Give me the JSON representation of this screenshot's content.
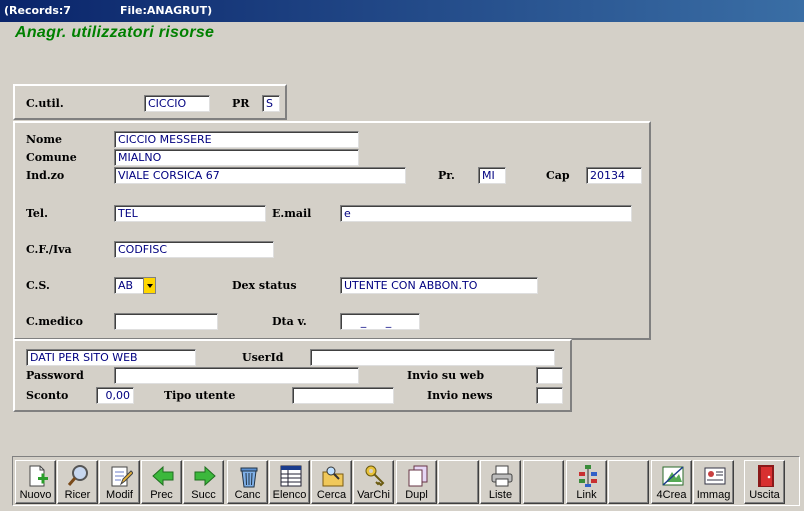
{
  "titlebar": {
    "records": "(Records:7",
    "file": "File:ANAGRUT)"
  },
  "heading": "Anagr. utilizzatori risorse",
  "form": {
    "cutil_label": "C.util.",
    "cutil_value": "CICCIO",
    "pr_top_label": "PR",
    "pr_top_value": "S",
    "nome_label": "Nome",
    "nome_value": "CICCIO MESSERE",
    "comune_label": "Comune",
    "comune_value": "MIALNO",
    "indzo_label": "Ind.zo",
    "indzo_value": "VIALE CORSICA 67",
    "prov_label": "Pr.",
    "prov_value": "MI",
    "cap_label": "Cap",
    "cap_value": "20134",
    "tel_label": "Tel.",
    "tel_value": "TEL",
    "email_label": "E.mail",
    "email_value": "e",
    "cf_label": "C.F./Iva",
    "cf_value": "CODFISC",
    "cs_label": "C.S.",
    "cs_value": "AB",
    "dexstatus_label": "Dex status",
    "dexstatus_value": "UTENTE CON ABBON.TO",
    "cmedico_label": "C.medico",
    "cmedico_value": "",
    "dtav_label": "Dta v.",
    "dtav_value": "_ _",
    "sitoweb_value": "DATI PER SITO WEB",
    "userid_label": "UserId",
    "userid_value": "",
    "password_label": "Password",
    "password_value": "",
    "inviosuweb_label": "Invio su web",
    "inviosuweb_value": "",
    "sconto_label": "Sconto",
    "sconto_value": "0,00",
    "tipoutente_label": "Tipo utente",
    "tipoutente_value": "",
    "invionews_label": "Invio news",
    "invionews_value": ""
  },
  "toolbar": [
    {
      "id": "nuovo",
      "label": "Nuovo",
      "icon": "new-document-icon"
    },
    {
      "id": "ricer",
      "label": "Ricer",
      "icon": "search-magnifier-icon"
    },
    {
      "id": "modif",
      "label": "Modif",
      "icon": "edit-document-icon"
    },
    {
      "id": "prec",
      "label": "Prec",
      "icon": "arrow-left-icon"
    },
    {
      "id": "succ",
      "label": "Succ",
      "icon": "arrow-right-icon"
    },
    {
      "id": "canc",
      "label": "Canc",
      "icon": "trash-can-icon"
    },
    {
      "id": "elenco",
      "label": "Elenco",
      "icon": "list-table-icon"
    },
    {
      "id": "cerca",
      "label": "Cerca",
      "icon": "search-folder-icon"
    },
    {
      "id": "varchi",
      "label": "VarChi",
      "icon": "keys-icon"
    },
    {
      "id": "dupl",
      "label": "Dupl",
      "icon": "duplicate-icon"
    },
    {
      "id": "blank1",
      "label": "",
      "icon": ""
    },
    {
      "id": "liste",
      "label": "Liste",
      "icon": "printer-icon"
    },
    {
      "id": "blank2",
      "label": "",
      "icon": ""
    },
    {
      "id": "link",
      "label": "Link",
      "icon": "link-tree-icon"
    },
    {
      "id": "blank3",
      "label": "",
      "icon": ""
    },
    {
      "id": "4crea",
      "label": "4Crea",
      "icon": "build-icon"
    },
    {
      "id": "immag",
      "label": "Immag",
      "icon": "image-card-icon"
    },
    {
      "id": "uscita",
      "label": "Uscita",
      "icon": "exit-door-icon"
    }
  ]
}
